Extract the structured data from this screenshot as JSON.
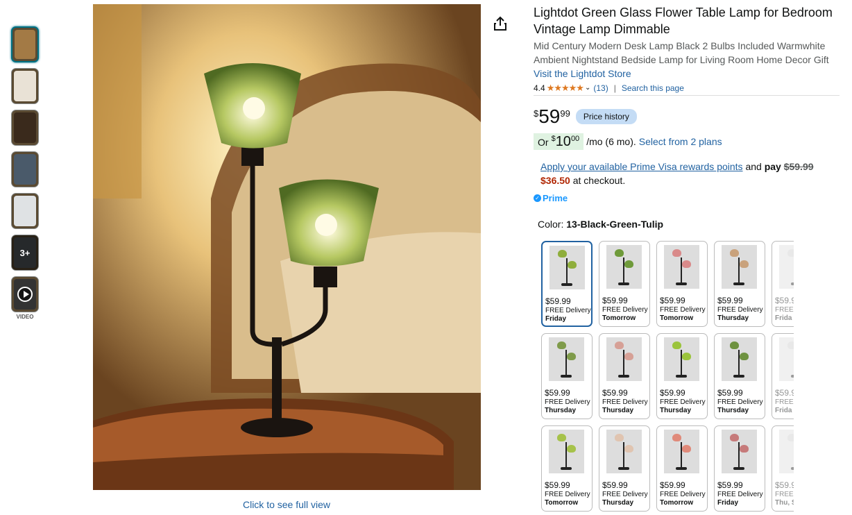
{
  "thumbnails": [
    {
      "name": "thumb-1",
      "color": "#a37a45"
    },
    {
      "name": "thumb-2",
      "color": "#e9e2d6"
    },
    {
      "name": "thumb-3",
      "color": "#3a2a1c"
    },
    {
      "name": "thumb-4",
      "color": "#4a5a6a"
    },
    {
      "name": "thumb-5",
      "color": "#dfe2e4"
    },
    {
      "name": "thumb-more",
      "color": "#555b60",
      "label": "3+"
    },
    {
      "name": "thumb-video",
      "color": "#333"
    }
  ],
  "video_label": "VIDEO",
  "full_view": "Click to see full view",
  "product": {
    "title": "Lightdot Green Glass Flower Table Lamp for Bedroom Vintage Lamp Dimmable",
    "subtitle": "Mid Century Modern Desk Lamp Black 2 Bulbs Included Warmwhite Ambient Nightstand Bedside Lamp for Living Room Home Decor Gift",
    "store": "Visit the Lightdot Store",
    "rating": "4.4",
    "stars": "★★★★★",
    "reviews": "(13)",
    "separator": "|",
    "search_page": "Search this page"
  },
  "price": {
    "currency": "$",
    "whole": "59",
    "fraction": "99",
    "history": "Price history"
  },
  "monthly": {
    "or": "Or",
    "currency": "$",
    "whole": "10",
    "fraction": "00",
    "term": "/mo (6 mo).",
    "plans": "Select from 2 plans"
  },
  "rewards": {
    "link": "Apply your available Prime Visa rewards points",
    "and_pay": "and",
    "pay": "pay",
    "old_price": "$59.99",
    "new_price": "$36.50",
    "suffix": "at checkout."
  },
  "prime": "Prime",
  "color": {
    "label": "Color:",
    "value": "13-Black-Green-Tulip"
  },
  "swatches": [
    {
      "price": "$59.99",
      "delivery": "FREE Delivery",
      "day": "Friday",
      "shade": "#8fae3c"
    },
    {
      "price": "$59.99",
      "delivery": "FREE Delivery",
      "day": "Tomorrow",
      "shade": "#6f9a3a"
    },
    {
      "price": "$59.99",
      "delivery": "FREE Delivery",
      "day": "Tomorrow",
      "shade": "#d98a8a"
    },
    {
      "price": "$59.99",
      "delivery": "FREE Delivery",
      "day": "Thursday",
      "shade": "#c9a27c"
    },
    {
      "price": "$59.9",
      "delivery": "FREE",
      "day": "Frida",
      "shade": "#ccc"
    },
    {
      "price": "$59.99",
      "delivery": "FREE Delivery",
      "day": "Thursday",
      "shade": "#7f9b4a"
    },
    {
      "price": "$59.99",
      "delivery": "FREE Delivery",
      "day": "Thursday",
      "shade": "#d6a096"
    },
    {
      "price": "$59.99",
      "delivery": "FREE Delivery",
      "day": "Thursday",
      "shade": "#9bc43c"
    },
    {
      "price": "$59.99",
      "delivery": "FREE Delivery",
      "day": "Thursday",
      "shade": "#6e9240"
    },
    {
      "price": "$59.9",
      "delivery": "FREE",
      "day": "Frida",
      "shade": "#ccc"
    },
    {
      "price": "$59.99",
      "delivery": "FREE Delivery",
      "day": "Tomorrow",
      "shade": "#a6c24a"
    },
    {
      "price": "$59.99",
      "delivery": "FREE Delivery",
      "day": "Thursday",
      "shade": "#e0c4b0"
    },
    {
      "price": "$59.99",
      "delivery": "FREE Delivery",
      "day": "Tomorrow",
      "shade": "#e08a7a"
    },
    {
      "price": "$59.99",
      "delivery": "FREE Delivery",
      "day": "Friday",
      "shade": "#c67a7a"
    },
    {
      "price": "$59.9",
      "delivery": "FREE",
      "day": "Thu, S",
      "shade": "#ccc"
    }
  ],
  "colors": {
    "link": "#2162a1",
    "accent": "#de7921",
    "price_red": "#b12704",
    "prime": "#1a98ff",
    "pill": "#c4dcf5",
    "green_box": "#dff2e1"
  }
}
